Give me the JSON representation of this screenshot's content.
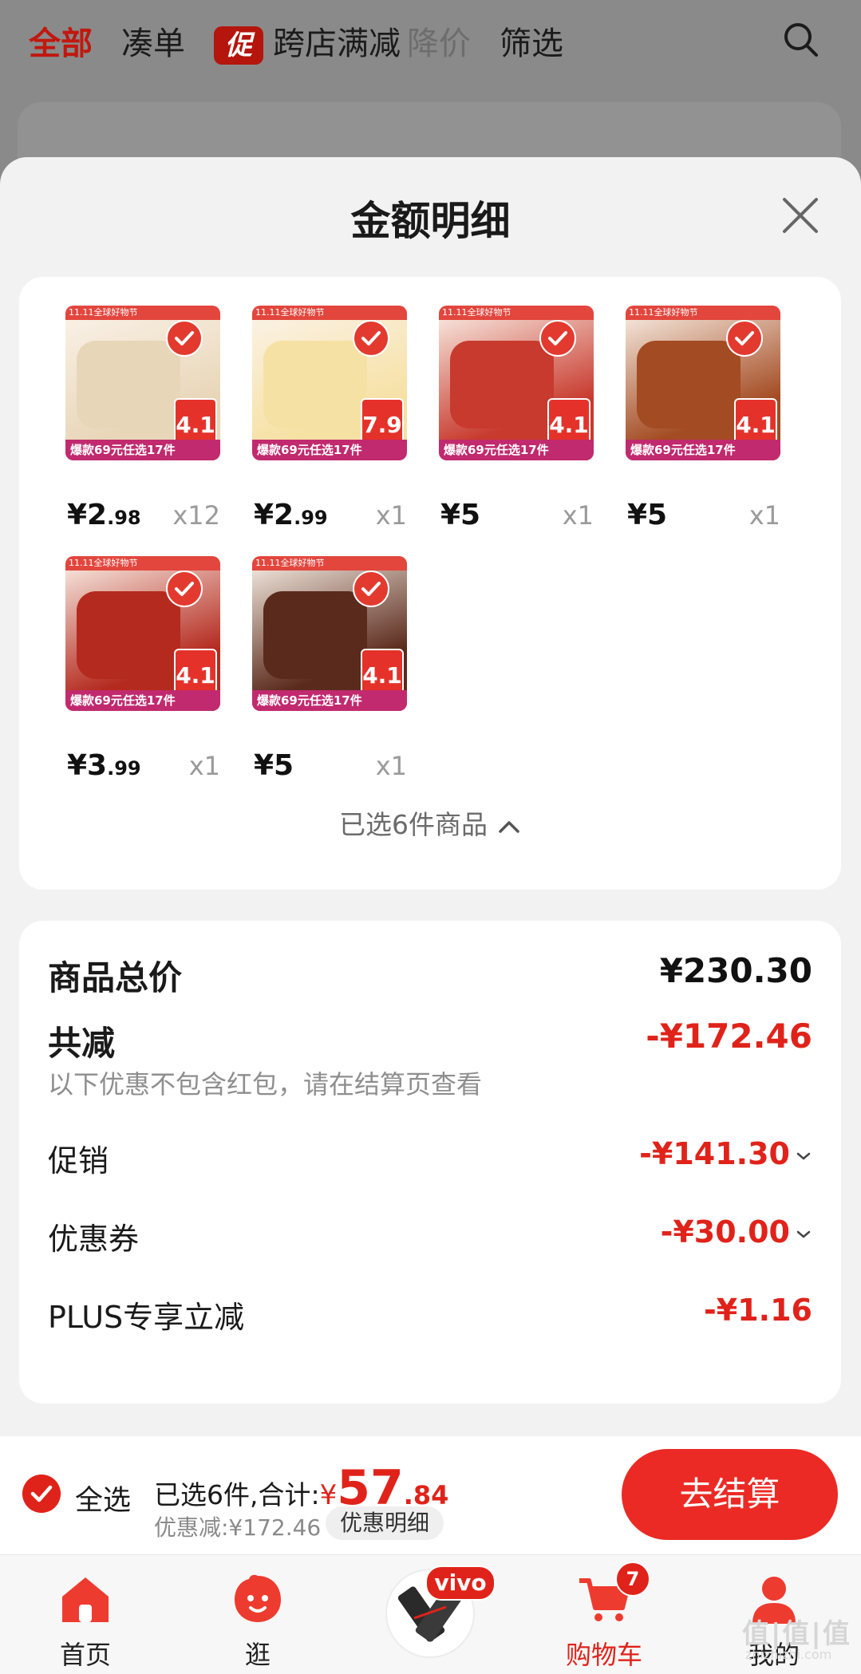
{
  "top_tabs": [
    {
      "label": "全部",
      "state": "active"
    },
    {
      "label": "凑单",
      "state": "normal"
    },
    {
      "label": "跨店满减",
      "state": "normal",
      "badge": "促"
    },
    {
      "label": "降价",
      "state": "muted"
    },
    {
      "label": "筛选",
      "state": "normal"
    }
  ],
  "sheet": {
    "title": "金额明细"
  },
  "products": [
    {
      "thumb_color": "#e8d6b8",
      "band_text": "爆款69元任选17件",
      "top_text": "11.11全球好物节",
      "tag": "4.1",
      "price_main": "¥2",
      "price_dec": ".98",
      "qty": "x12"
    },
    {
      "thumb_color": "#f6e1a4",
      "band_text": "爆款69元任选17件",
      "top_text": "11.11全球好物节",
      "tag": "7.9",
      "price_main": "¥2",
      "price_dec": ".99",
      "qty": "x1"
    },
    {
      "thumb_color": "#c83a2e",
      "band_text": "爆款69元任选17件",
      "top_text": "11.11全球好物节",
      "tag": "4.1",
      "price_main": "¥5",
      "price_dec": "",
      "qty": "x1"
    },
    {
      "thumb_color": "#a34b22",
      "band_text": "爆款69元任选17件",
      "top_text": "11.11全球好物节",
      "tag": "4.1",
      "price_main": "¥5",
      "price_dec": "",
      "qty": "x1"
    },
    {
      "thumb_color": "#b42a1f",
      "band_text": "爆款69元任选17件",
      "top_text": "11.11全球好物节",
      "tag": "4.1",
      "price_main": "¥3",
      "price_dec": ".99",
      "qty": "x1"
    },
    {
      "thumb_color": "#5a2a1c",
      "band_text": "爆款69元任选17件",
      "top_text": "11.11全球好物节",
      "tag": "4.1",
      "price_main": "¥5",
      "price_dec": "",
      "qty": "x1"
    }
  ],
  "selected_summary": "已选6件商品",
  "summary": {
    "total_label": "商品总价",
    "total_value": "¥230.30",
    "reduce_label": "共减",
    "reduce_value": "-¥172.46",
    "reduce_hint": "以下优惠不包含红包，请在结算页查看",
    "promo_label": "促销",
    "promo_value": "-¥141.30",
    "coupon_label": "优惠券",
    "coupon_value": "-¥30.00",
    "plus_label": "PLUS专享立减",
    "plus_value": "-¥1.16"
  },
  "checkout": {
    "select_all": "全选",
    "selected_text": "已选6件,合计:",
    "currency": "¥",
    "amount_int": "57",
    "amount_dec": ".84",
    "discount_text": "优惠减:¥172.46",
    "detail_label": "优惠明细",
    "button_label": "去结算"
  },
  "tabbar": [
    {
      "label": "首页",
      "active": false
    },
    {
      "label": "逛",
      "active": false
    },
    {
      "label": "",
      "active": false
    },
    {
      "label": "购物车",
      "active": true,
      "badge": "7"
    },
    {
      "label": "我的",
      "active": false
    }
  ],
  "vivo_badge": "vivo",
  "watermark": "值|值|值",
  "watermark_sub": "zhizhizhi.com",
  "colors": {
    "accent": "#e0231a",
    "active_tab": "#c0180f"
  }
}
